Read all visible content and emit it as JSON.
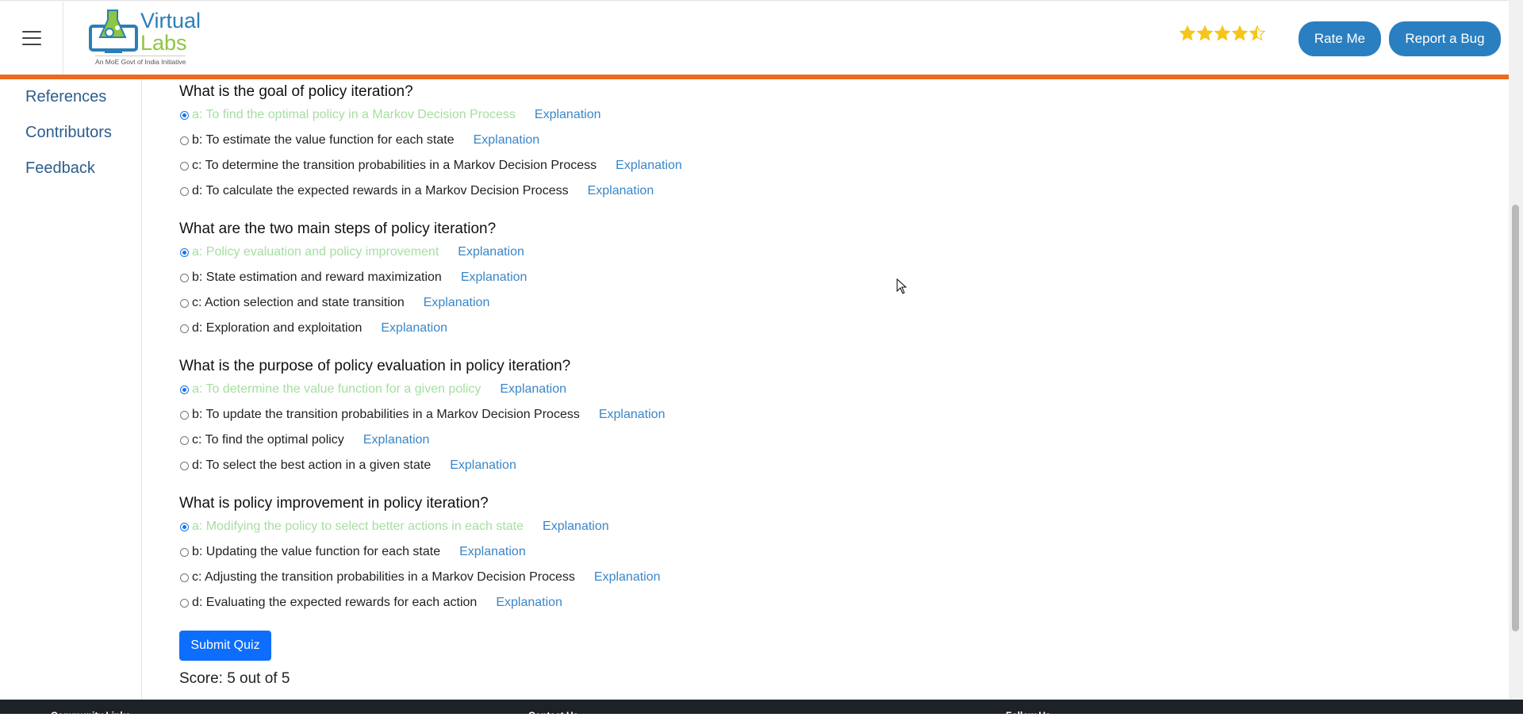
{
  "header": {
    "logo": {
      "line1": "Virtual",
      "line2": "Labs",
      "tagline": "An MoE Govt of India Initiative"
    },
    "rating": {
      "value": 4.5,
      "max": 5,
      "color": "#f5c518"
    },
    "rate_button": "Rate Me",
    "bug_button": "Report a Bug",
    "accent_color": "#ec6a1b"
  },
  "sidebar": {
    "items": [
      {
        "label": "References"
      },
      {
        "label": "Contributors"
      },
      {
        "label": "Feedback"
      }
    ]
  },
  "quiz": {
    "explanation_label": "Explanation",
    "questions": [
      {
        "text": "What is the goal of policy iteration?",
        "options": [
          {
            "label": "a: To find the optimal policy in a Markov Decision Process",
            "selected": true,
            "correct": true
          },
          {
            "label": "b: To estimate the value function for each state",
            "selected": false
          },
          {
            "label": "c: To determine the transition probabilities in a Markov Decision Process",
            "selected": false
          },
          {
            "label": "d: To calculate the expected rewards in a Markov Decision Process",
            "selected": false
          }
        ]
      },
      {
        "text": "What are the two main steps of policy iteration?",
        "options": [
          {
            "label": "a: Policy evaluation and policy improvement",
            "selected": true,
            "correct": true
          },
          {
            "label": "b: State estimation and reward maximization",
            "selected": false
          },
          {
            "label": "c: Action selection and state transition",
            "selected": false
          },
          {
            "label": "d: Exploration and exploitation",
            "selected": false
          }
        ]
      },
      {
        "text": "What is the purpose of policy evaluation in policy iteration?",
        "options": [
          {
            "label": "a: To determine the value function for a given policy",
            "selected": true,
            "correct": true
          },
          {
            "label": "b: To update the transition probabilities in a Markov Decision Process",
            "selected": false
          },
          {
            "label": "c: To find the optimal policy",
            "selected": false
          },
          {
            "label": "d: To select the best action in a given state",
            "selected": false
          }
        ]
      },
      {
        "text": "What is policy improvement in policy iteration?",
        "options": [
          {
            "label": "a: Modifying the policy to select better actions in each state",
            "selected": true,
            "correct": true
          },
          {
            "label": "b: Updating the value function for each state",
            "selected": false
          },
          {
            "label": "c: Adjusting the transition probabilities in a Markov Decision Process",
            "selected": false
          },
          {
            "label": "d: Evaluating the expected rewards for each action",
            "selected": false
          }
        ]
      }
    ],
    "submit_label": "Submit Quiz",
    "score_text": "Score: 5 out of 5"
  },
  "footer": {
    "col1": "Community Links",
    "col2": "Contact Us",
    "col3": "Follow Us"
  }
}
